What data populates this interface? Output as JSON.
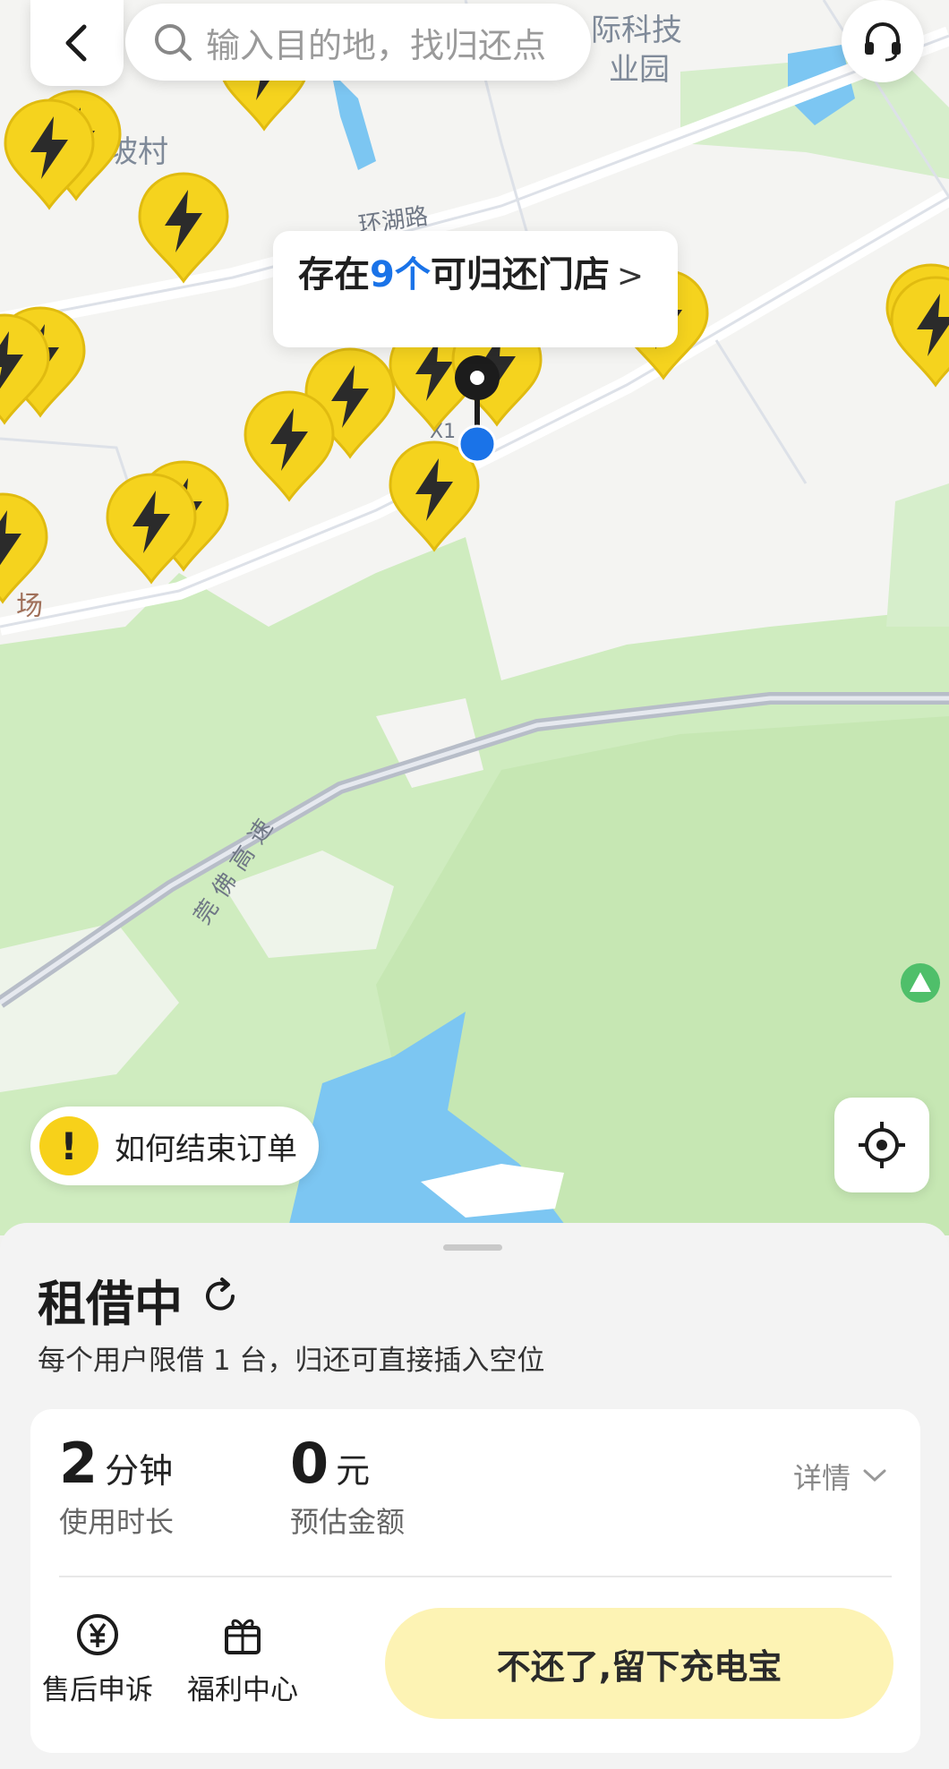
{
  "search": {
    "placeholder": "输入目的地，找归还点"
  },
  "map": {
    "labels": {
      "poi_top_right": "际科技",
      "poi_top_right_2": "业园",
      "village": "坡村",
      "road_hu": "环湖路",
      "place_left": "场",
      "road_x": "X1",
      "highway": "莞佛高速"
    },
    "popup": {
      "prefix": "存在",
      "count": "9个",
      "suffix": "可归还门店",
      "chevron": ">"
    },
    "help_chip": {
      "icon": "!",
      "text": "如何结束订单"
    }
  },
  "order": {
    "status": "租借中",
    "limit_note": "每个用户限借 1 台，归还可直接插入空位",
    "duration": {
      "value": "2",
      "unit": "分钟",
      "label": "使用时长"
    },
    "amount": {
      "value": "0",
      "unit": "元",
      "label": "预估金额"
    },
    "details_label": "详情",
    "actions": [
      {
        "label": "售后申诉",
        "icon": "yuan-icon"
      },
      {
        "label": "福利中心",
        "icon": "gift-icon"
      }
    ],
    "keep_button": "不还了,留下充电宝"
  },
  "colors": {
    "pin_yellow": "#f5d31e",
    "accent_blue": "#1a73e8",
    "keep_button_bg": "#fdf3b4"
  }
}
